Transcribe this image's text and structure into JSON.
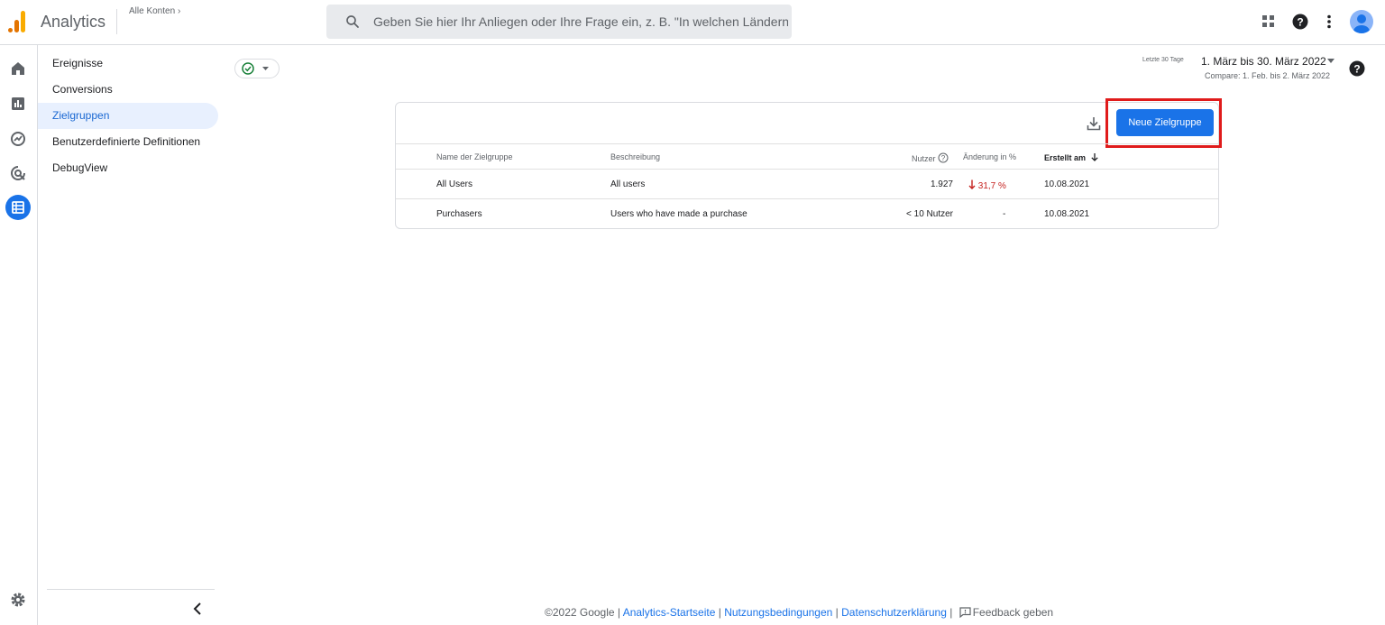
{
  "header": {
    "app_title": "Analytics",
    "accounts_label": "Alle Konten",
    "search_placeholder": "Geben Sie hier Ihr Anliegen oder Ihre Frage ein, z. B. \"In welchen Ländern ..."
  },
  "sidenav": {
    "items": [
      {
        "label": "Ereignisse",
        "active": false
      },
      {
        "label": "Conversions",
        "active": false
      },
      {
        "label": "Zielgruppen",
        "active": true
      },
      {
        "label": "Benutzerdefinierte Definitionen",
        "active": false
      },
      {
        "label": "DebugView",
        "active": false
      }
    ]
  },
  "date": {
    "preset": "Letzte 30 Tage",
    "range": "1. März bis 30. März 2022",
    "compare": "Compare: 1. Feb. bis 2. März 2022"
  },
  "audiences": {
    "new_button": "Neue Zielgruppe",
    "columns": {
      "name": "Name der Zielgruppe",
      "description": "Beschreibung",
      "users": "Nutzer",
      "change": "Änderung in %",
      "created": "Erstellt am"
    },
    "rows": [
      {
        "name": "All Users",
        "description": "All users",
        "users": "1.927",
        "change": "31,7 %",
        "created": "10.08.2021"
      },
      {
        "name": "Purchasers",
        "description": "Users who have made a purchase",
        "users": "< 10 Nutzer",
        "change": "-",
        "created": "10.08.2021"
      }
    ]
  },
  "footer": {
    "copyright": "©2022 Google |",
    "link_home": "Analytics-Startseite",
    "sep1": "|",
    "link_terms": "Nutzungsbedingungen",
    "sep2": "|",
    "link_privacy": "Datenschutzerklärung",
    "sep3": "|",
    "feedback": "Feedback geben"
  },
  "colors": {
    "accent": "#1a73e8",
    "highlight": "#e01b1b",
    "negative": "#c5221f"
  }
}
